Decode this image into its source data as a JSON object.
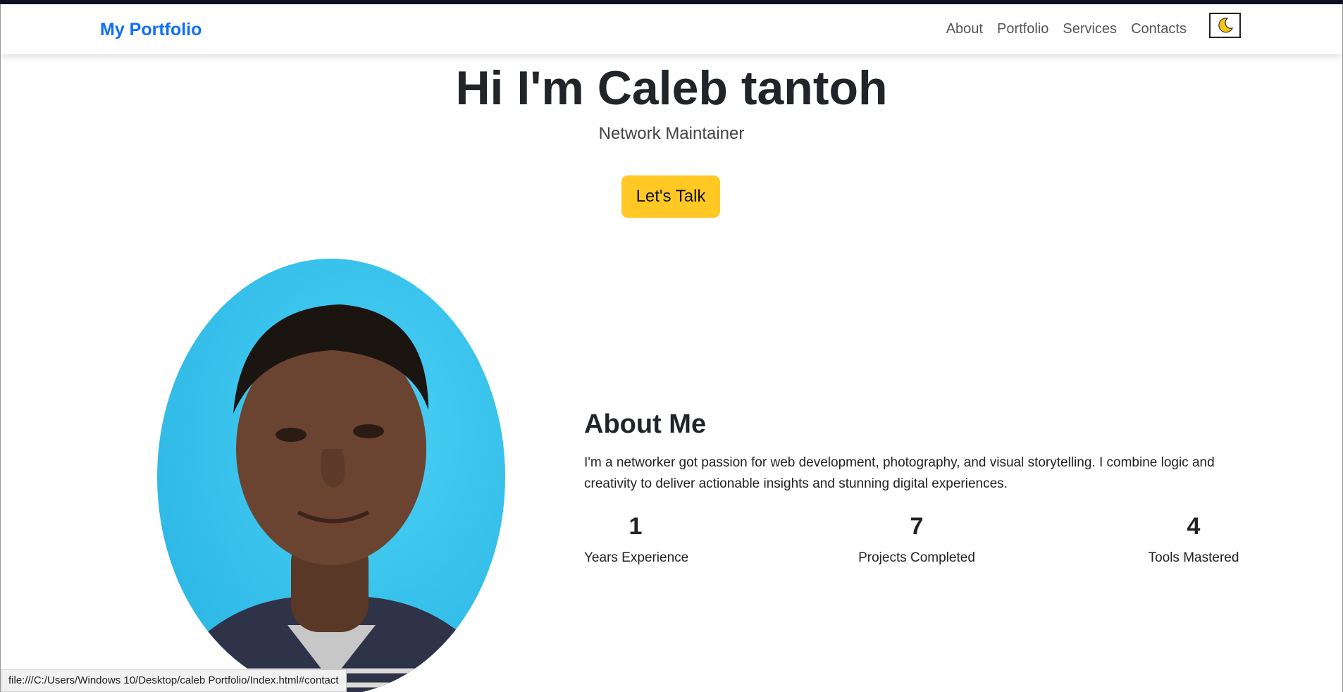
{
  "navbar": {
    "brand": "My Portfolio",
    "links": [
      "About",
      "Portfolio",
      "Services",
      "Contacts"
    ],
    "theme_toggle_icon": "moon-icon"
  },
  "hero": {
    "title": "Hi I'm Caleb tantoh",
    "subtitle": "Network Maintainer",
    "cta_label": "Let's Talk"
  },
  "about": {
    "title": "About Me",
    "text": "I'm a networker got passion for web development, photography, and visual storytelling. I combine logic and creativity to deliver actionable insights and stunning digital experiences.",
    "stats": [
      {
        "value": "1",
        "label": "Years Experience"
      },
      {
        "value": "7",
        "label": "Projects Completed"
      },
      {
        "value": "4",
        "label": "Tools Mastered"
      }
    ]
  },
  "status_bar": {
    "url": "file:///C:/Users/Windows 10/Desktop/caleb Portfolio/Index.html#contact"
  },
  "colors": {
    "accent": "#0d6efd",
    "cta": "#ffc824",
    "portrait_background": "#39c3ec"
  }
}
